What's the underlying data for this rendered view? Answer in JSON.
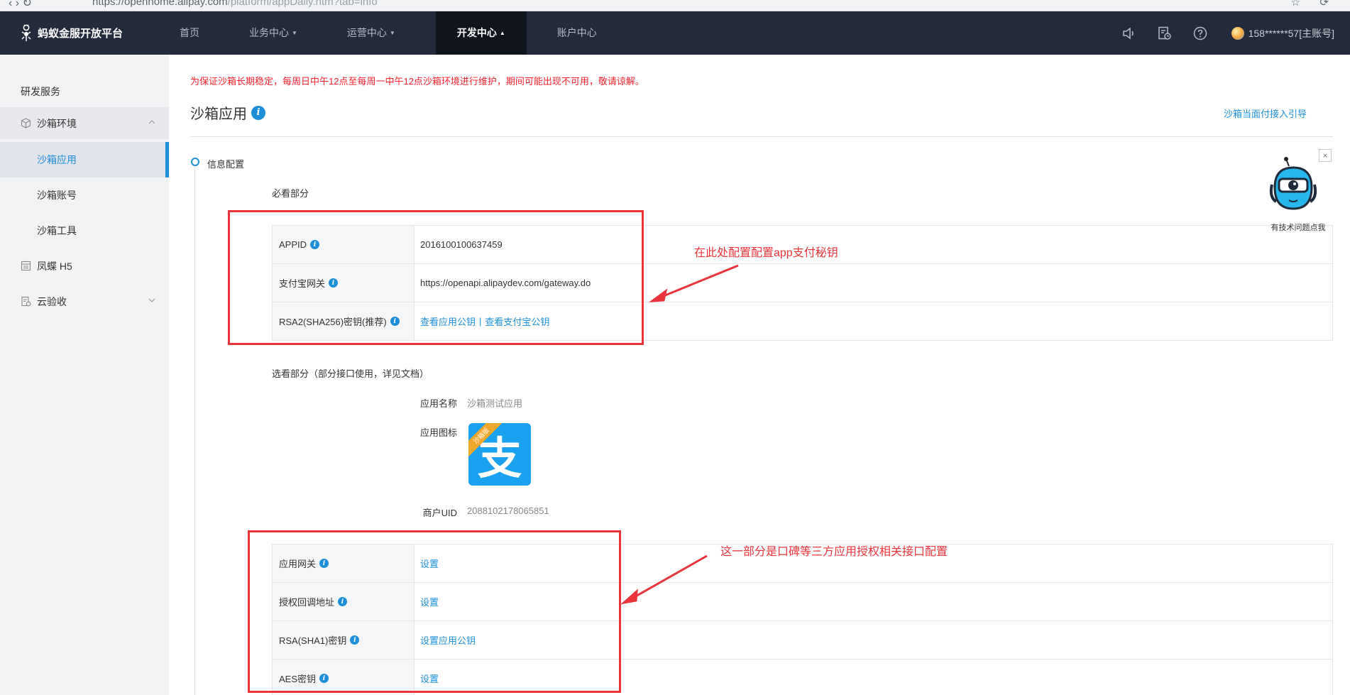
{
  "browser": {
    "url_host": "https://openhome.alipay.com",
    "url_path": "/platform/appDaily.htm?tab=info"
  },
  "topnav": {
    "brand": "蚂蚁金服开放平台",
    "menu": [
      {
        "label": "首页",
        "caret": ""
      },
      {
        "label": "业务中心",
        "caret": "▼"
      },
      {
        "label": "运营中心",
        "caret": "▼"
      },
      {
        "label": "开发中心",
        "caret": "▲"
      },
      {
        "label": "账户中心",
        "caret": ""
      }
    ],
    "account": "158******57[主账号]"
  },
  "sidebar": {
    "title": "研发服务",
    "groups": [
      {
        "label": "沙箱环境",
        "icon": "cube-icon"
      },
      {
        "label": "凤蝶 H5",
        "icon": "layout-icon"
      },
      {
        "label": "云验收",
        "icon": "checklist-icon"
      }
    ],
    "items": [
      {
        "label": "沙箱应用"
      },
      {
        "label": "沙箱账号"
      },
      {
        "label": "沙箱工具"
      }
    ]
  },
  "main": {
    "notice": "为保证沙箱长期稳定，每周日中午12点至每周一中午12点沙箱环境进行维护，期间可能出现不可用，敬请谅解。",
    "title": "沙箱应用",
    "info_glyph": "i",
    "guide_link": "沙箱当面付接入引导",
    "section": "信息配置",
    "required_title": "必看部分",
    "required": [
      {
        "key": "APPID",
        "value": "2016100100637459"
      },
      {
        "key": "支付宝网关",
        "value": "https://openapi.alipaydev.com/gateway.do"
      },
      {
        "key": "RSA2(SHA256)密钥(推荐)",
        "link1": "查看应用公钥",
        "sep": "|",
        "link2": "查看支付宝公钥"
      }
    ],
    "optional_title": "选看部分（部分接口使用，详见文档）",
    "app_name_label": "应用名称",
    "app_name": "沙箱测试应用",
    "app_icon_label": "应用图标",
    "app_icon_ribbon": "沙箱版",
    "app_icon_glyph": "支",
    "uid_label": "商户UID",
    "uid": "2088102178065851",
    "optional": [
      {
        "key": "应用网关",
        "link": "设置"
      },
      {
        "key": "授权回调地址",
        "link": "设置"
      },
      {
        "key": "RSA(SHA1)密钥",
        "link": "设置应用公钥"
      },
      {
        "key": "AES密钥",
        "link": "设置"
      }
    ]
  },
  "annotations": {
    "note1": "在此处配置配置app支付秘钥",
    "note2": "这一部分是口碑等三方应用授权相关接口配置"
  },
  "helper": {
    "close": "×",
    "caption": "有技术问题点我"
  },
  "colors": {
    "nav_bg": "#232a3b",
    "accent": "#1d8fd9",
    "notice": "#f5222d",
    "annotation": "#e8343a"
  }
}
